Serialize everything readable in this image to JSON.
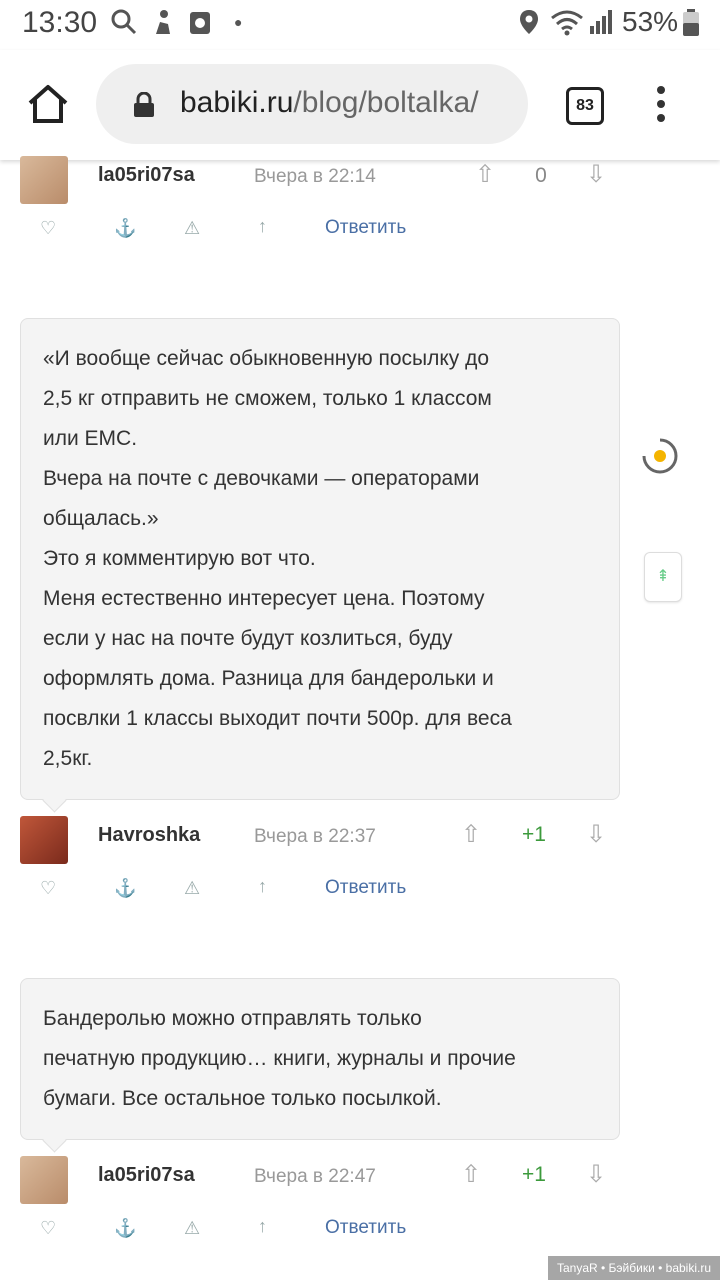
{
  "status_bar": {
    "time": "13:30",
    "battery": "53%",
    "icons": [
      "search-icon",
      "fitness-icon",
      "recorder-icon",
      "dot-icon",
      "location-icon",
      "wifi-icon",
      "signal-icon",
      "battery-icon"
    ]
  },
  "browser": {
    "url_domain": "babiki.ru",
    "url_path": "/blog/boltalka/",
    "tab_count": "83"
  },
  "comments": [
    {
      "username": "la05ri07sa",
      "date": "Вчера в 22:14",
      "score": "0",
      "reply_label": "Ответить"
    },
    {
      "username": "Havroshka",
      "date": "Вчера в 22:37",
      "score": "+1",
      "reply_label": "Ответить",
      "text": [
        "«И вообще сейчас обыкновенную посылку до",
        "2,5 кг отправить не сможем, только 1 классом",
        "или EMC.",
        "Вчера на почте с девочками — операторами",
        "общалась.»",
        "Это я комментирую вот что.",
        "Меня естественно интересует цена. Поэтому",
        "если у нас на почте будут козлиться, буду",
        "оформлять дома. Разница для бандерольки и",
        "посвлки 1 классы выходит почти 500р. для веса",
        "2,5кг."
      ]
    },
    {
      "username": "la05ri07sa",
      "date": "Вчера в 22:47",
      "score": "+1",
      "reply_label": "Ответить",
      "text": [
        "Бандеролью можно отправлять только",
        "печатную продукцию… книги, журналы и прочие",
        "бумаги. Все остальное только посылкой."
      ]
    }
  ],
  "watermark": "TanyaR • Бэйбики • babiki.ru",
  "colors": {
    "accent_link": "#4a6fa5",
    "positive_score": "#3c9a3c",
    "bubble_bg": "#f4f4f4"
  }
}
